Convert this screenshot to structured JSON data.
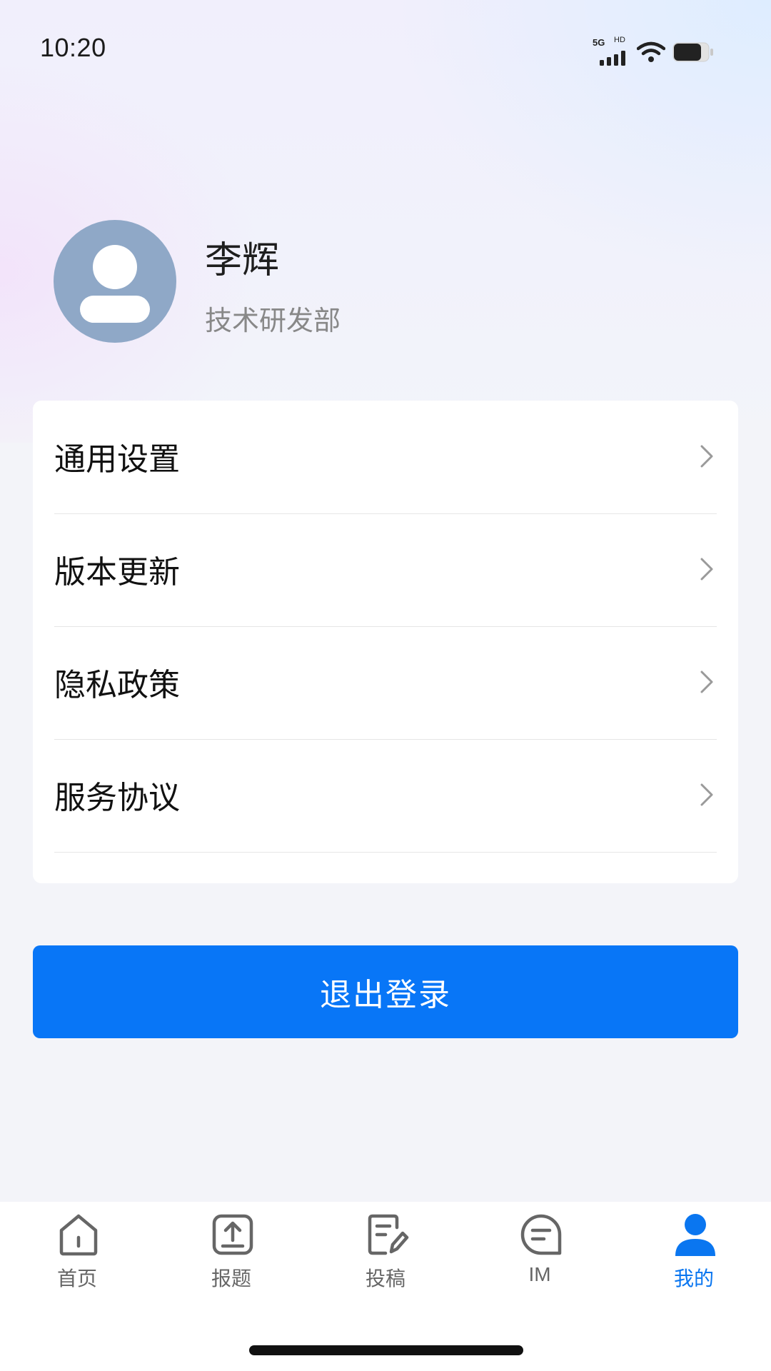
{
  "status_bar": {
    "time": "10:20",
    "network_label": "5G",
    "hd_label": "HD",
    "icons": [
      "signal-icon",
      "wifi-icon",
      "battery-icon"
    ]
  },
  "profile": {
    "name": "李辉",
    "department": "技术研发部",
    "avatar_icon": "user-avatar-icon"
  },
  "menu": {
    "items": [
      {
        "label": "通用设置"
      },
      {
        "label": "版本更新"
      },
      {
        "label": "隐私政策"
      },
      {
        "label": "服务协议"
      }
    ]
  },
  "logout": {
    "label": "退出登录"
  },
  "tab_bar": {
    "tabs": [
      {
        "label": "首页",
        "icon": "home-icon",
        "active": false
      },
      {
        "label": "报题",
        "icon": "upload-icon",
        "active": false
      },
      {
        "label": "投稿",
        "icon": "edit-document-icon",
        "active": false
      },
      {
        "label": "IM",
        "icon": "chat-icon",
        "active": false
      },
      {
        "label": "我的",
        "icon": "user-icon",
        "active": true
      }
    ]
  },
  "colors": {
    "accent": "#0876F7",
    "avatar_bg": "#8FA8C7",
    "inactive_tab": "#666666"
  }
}
